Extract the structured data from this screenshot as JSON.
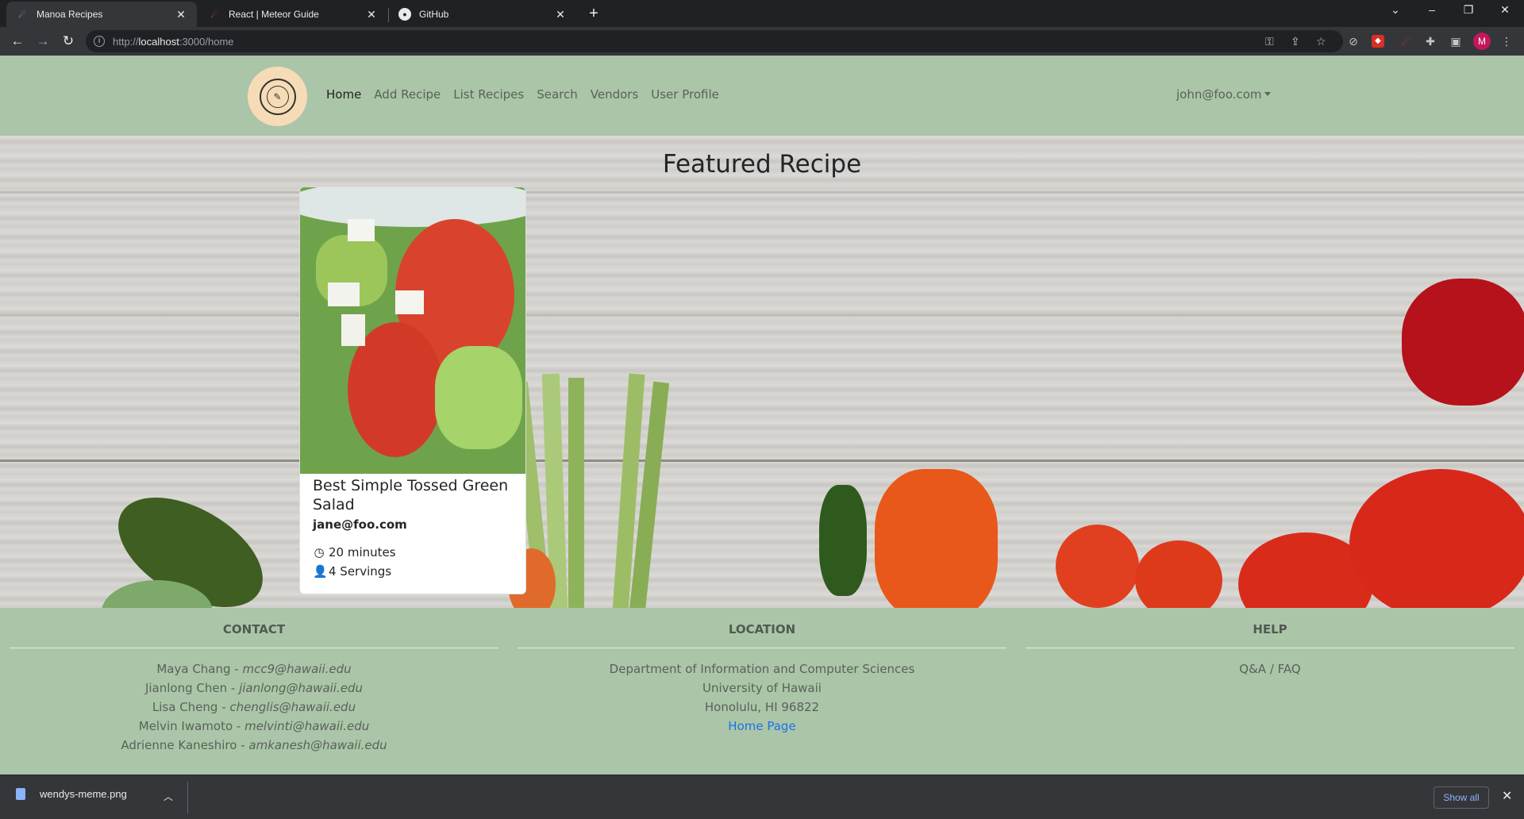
{
  "browser": {
    "tabs": [
      {
        "title": "Manoa Recipes",
        "icon": "meteor-icon",
        "active": true
      },
      {
        "title": "React | Meteor Guide",
        "icon": "meteor-icon",
        "active": false
      },
      {
        "title": "GitHub",
        "icon": "github-icon",
        "active": false
      }
    ],
    "url_prefix": "http://",
    "url_host": "localhost",
    "url_path": ":3000/home",
    "profile_initial": "M"
  },
  "navbar": {
    "logo_alt": "Manoa Recipes logo",
    "links": [
      {
        "label": "Home",
        "active": true
      },
      {
        "label": "Add Recipe",
        "active": false
      },
      {
        "label": "List Recipes",
        "active": false
      },
      {
        "label": "Search",
        "active": false
      },
      {
        "label": "Vendors",
        "active": false
      },
      {
        "label": "User Profile",
        "active": false
      }
    ],
    "user": "john@foo.com"
  },
  "hero": {
    "title": "Featured Recipe"
  },
  "card": {
    "title": "Best Simple Tossed Green Salad",
    "owner": "jane@foo.com",
    "time": "20 minutes",
    "servings": "4 Servings"
  },
  "footer": {
    "contact": {
      "heading": "CONTACT",
      "people": [
        {
          "name": "Maya Chang",
          "email": "mcc9@hawaii.edu"
        },
        {
          "name": "Jianlong Chen",
          "email": "jianlong@hawaii.edu"
        },
        {
          "name": "Lisa Cheng",
          "email": "chenglis@hawaii.edu"
        },
        {
          "name": "Melvin Iwamoto",
          "email": "melvinti@hawaii.edu"
        },
        {
          "name": "Adrienne Kaneshiro",
          "email": "amkanesh@hawaii.edu"
        }
      ]
    },
    "location": {
      "heading": "LOCATION",
      "line1": "Department of Information and Computer Sciences",
      "line2": "University of Hawaii",
      "line3": "Honolulu, HI 96822",
      "link": "Home Page"
    },
    "help": {
      "heading": "HELP",
      "link": "Q&A / FAQ"
    }
  },
  "downloads": {
    "file": "wendys-meme.png",
    "show_all": "Show all"
  },
  "colors": {
    "page_green": "#abc5a8",
    "link_blue": "#1a73e8"
  }
}
